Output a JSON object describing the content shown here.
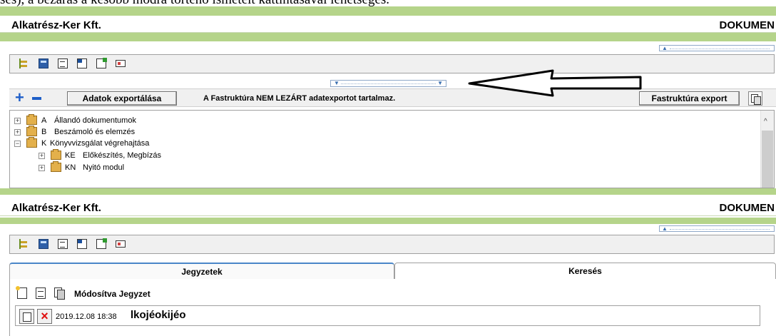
{
  "document_snippet": "sés), a bezárás a később módra történő ismételt kattintásával lehetséges.",
  "app": {
    "company": "Alkatrész-Ker Kft.",
    "doc_label": "DOKUMEN"
  },
  "export_bar": {
    "export_button": "Adatok exportálása",
    "status": "A Fastruktúra NEM LEZÁRT adatexportot tartalmaz.",
    "tree_export_button": "Fastruktúra export"
  },
  "tree": {
    "items": [
      {
        "code": "A",
        "label": "Állandó dokumentumok",
        "expander": "+"
      },
      {
        "code": "B",
        "label": "Beszámoló és elemzés",
        "expander": "+"
      },
      {
        "code": "K",
        "label": "Könyvvizsgálat végrehajtása",
        "expander": "−"
      },
      {
        "code": "KE",
        "label": "Előkészítés, Megbízás",
        "expander": "+"
      },
      {
        "code": "KN",
        "label": "Nyitó modul",
        "expander": "+"
      }
    ]
  },
  "tabs": [
    {
      "label": "Jegyzetek",
      "active": true
    },
    {
      "label": "Keresés",
      "active": false
    }
  ],
  "notes": {
    "column_header": "Módosítva Jegyzet",
    "rows": [
      {
        "date": "2019.12.08 18:38",
        "text": "lkojéokijéo"
      }
    ]
  },
  "colors": {
    "accent_green": "#b5d48a",
    "plus_blue": "#1f5fc8",
    "delete_red": "#e01010",
    "tab_active_border": "#4a86c8"
  }
}
